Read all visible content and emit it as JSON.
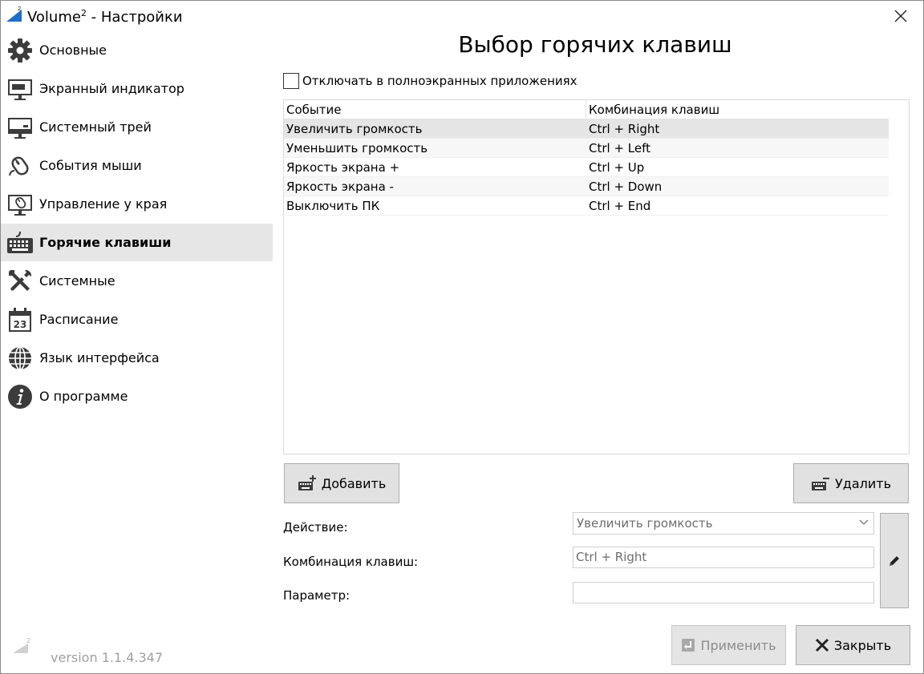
{
  "window": {
    "app_name": "Volume",
    "app_sup": "2",
    "title_rest": " - Настройки"
  },
  "sidebar": {
    "items": [
      {
        "label": "Основные",
        "icon": "gear-icon"
      },
      {
        "label": "Экранный индикатор",
        "icon": "monitor-icon"
      },
      {
        "label": "Системный трей",
        "icon": "tray-monitor-icon"
      },
      {
        "label": "События мыши",
        "icon": "mouse-icon"
      },
      {
        "label": "Управление у края",
        "icon": "screen-edge-icon"
      },
      {
        "label": "Горячие клавиши",
        "icon": "keyboard-icon",
        "active": true
      },
      {
        "label": "Системные",
        "icon": "tools-icon"
      },
      {
        "label": "Расписание",
        "icon": "calendar-icon",
        "calendar_day": "23"
      },
      {
        "label": "Язык интерфейса",
        "icon": "globe-icon"
      },
      {
        "label": "О программе",
        "icon": "info-icon"
      }
    ],
    "version": "version 1.1.4.347"
  },
  "main": {
    "title": "Выбор горячих клавиш",
    "fullscreen_checkbox": {
      "label": "Отключать в полноэкранных приложениях",
      "checked": false
    },
    "table": {
      "columns": [
        "Событие",
        "Комбинация клавиш"
      ],
      "rows": [
        {
          "event": "Увеличить громкость",
          "combo": "Ctrl + Right",
          "selected": true
        },
        {
          "event": "Уменьшить громкость",
          "combo": "Ctrl + Left"
        },
        {
          "event": "Яркость экрана +",
          "combo": "Ctrl + Up"
        },
        {
          "event": "Яркость экрана -",
          "combo": "Ctrl + Down"
        },
        {
          "event": "Выключить ПК",
          "combo": "Ctrl + End"
        }
      ]
    },
    "add_button": "Добавить",
    "delete_button": "Удалить",
    "form": {
      "action_label": "Действие:",
      "action_value": "Увеличить громкость",
      "hotkey_label": "Комбинация клавиш:",
      "hotkey_value": "Ctrl + Right",
      "param_label": "Параметр:",
      "param_value": ""
    },
    "apply_button": "Применить",
    "close_button": "Закрыть"
  },
  "colors": {
    "active_item_bg": "#e6e6e6",
    "button_bg": "#e1e1e1",
    "icon_dark": "#3c3c3c",
    "accent_blue": "#1e6fc5"
  }
}
